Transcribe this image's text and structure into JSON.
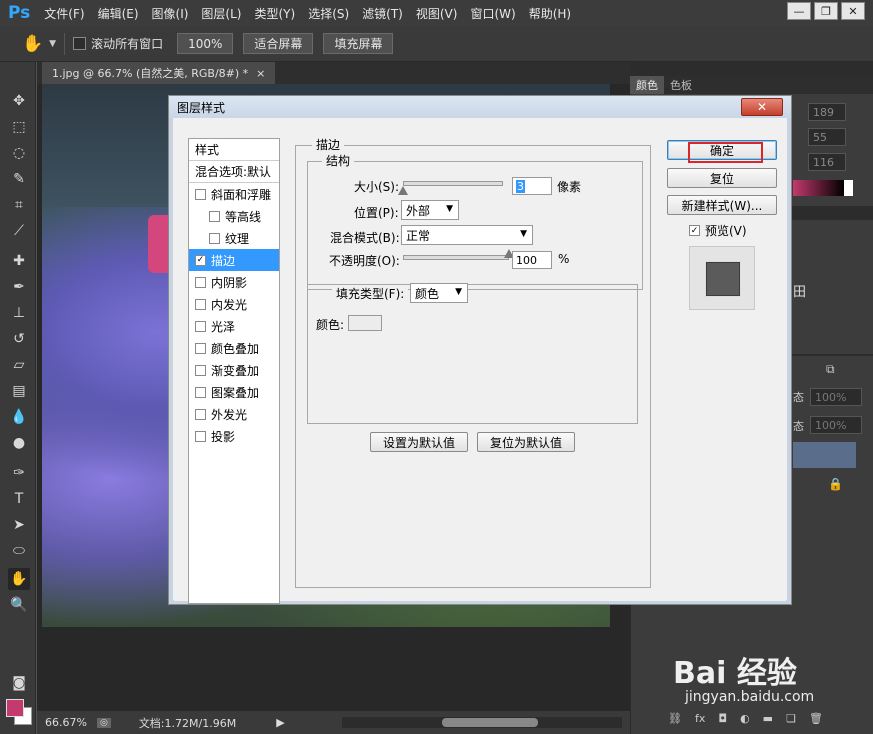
{
  "app": {
    "logo": "Ps",
    "menu": [
      "文件(F)",
      "编辑(E)",
      "图像(I)",
      "图层(L)",
      "类型(Y)",
      "选择(S)",
      "滤镜(T)",
      "视图(V)",
      "窗口(W)",
      "帮助(H)"
    ]
  },
  "options": {
    "scroll_all_label": "滚动所有窗口",
    "zoom_btn": "100%",
    "fit_btn": "适合屏幕",
    "fill_btn": "填充屏幕"
  },
  "document": {
    "tab_label": "1.jpg @ 66.7% (自然之美, RGB/8#) *",
    "zoom": "66.67%",
    "doc_size": "文档:1.72M/1.96M"
  },
  "right_panel": {
    "tabs": [
      "颜色",
      "色板"
    ],
    "rgb_values": [
      "189",
      "55",
      "116"
    ],
    "opacity_values": [
      "100%",
      "100%"
    ],
    "partial_labels": [
      "田",
      "态",
      "态"
    ]
  },
  "dialog": {
    "title": "图层样式",
    "close_label": "✕",
    "styles_header": "样式",
    "blend_options": "混合选项:默认",
    "style_items": [
      {
        "label": "斜面和浮雕",
        "checked": false,
        "sub": false
      },
      {
        "label": "等高线",
        "checked": false,
        "sub": true
      },
      {
        "label": "纹理",
        "checked": false,
        "sub": true
      },
      {
        "label": "描边",
        "checked": true,
        "sub": false,
        "selected": true
      },
      {
        "label": "内阴影",
        "checked": false,
        "sub": false
      },
      {
        "label": "内发光",
        "checked": false,
        "sub": false
      },
      {
        "label": "光泽",
        "checked": false,
        "sub": false
      },
      {
        "label": "颜色叠加",
        "checked": false,
        "sub": false
      },
      {
        "label": "渐变叠加",
        "checked": false,
        "sub": false
      },
      {
        "label": "图案叠加",
        "checked": false,
        "sub": false
      },
      {
        "label": "外发光",
        "checked": false,
        "sub": false
      },
      {
        "label": "投影",
        "checked": false,
        "sub": false
      }
    ],
    "stroke": {
      "section_title": "描边",
      "structure_title": "结构",
      "size_label": "大小(S):",
      "size_value": "3",
      "size_unit": "像素",
      "position_label": "位置(P):",
      "position_value": "外部",
      "blend_label": "混合模式(B):",
      "blend_value": "正常",
      "opacity_label": "不透明度(O):",
      "opacity_value": "100",
      "opacity_unit": "%",
      "fill_type_label": "填充类型(F):",
      "fill_type_value": "颜色",
      "color_label": "颜色:",
      "color_value": "#ececec",
      "size_fraction": 0.0,
      "opacity_fraction": 1.0
    },
    "buttons": {
      "ok": "确定",
      "reset": "复位",
      "new_style": "新建样式(W)...",
      "preview": "预览(V)",
      "set_default": "设置为默认值",
      "reset_default": "复位为默认值"
    },
    "preview_checked": true
  },
  "watermark": {
    "brand": "Bai 经验",
    "url": "jingyan.baidu.com"
  }
}
